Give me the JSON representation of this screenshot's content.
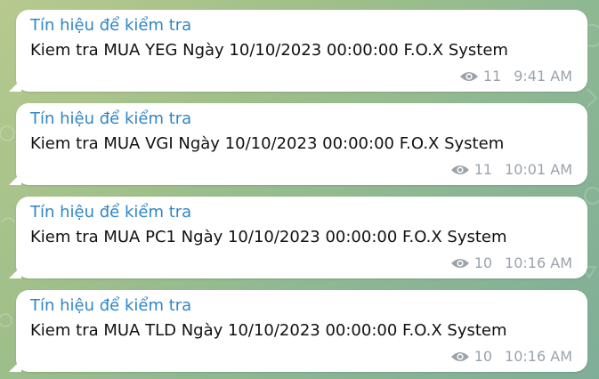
{
  "colors": {
    "sender": "#2f86c8",
    "meta": "#9aa3ab",
    "bubble": "#ffffff"
  },
  "messages": [
    {
      "sender": "Tín hiệu để kiểm tra",
      "text": "Kiem tra MUA YEG Ngày 10/10/2023 00:00:00 F.O.X System",
      "views": "11",
      "time": "9:41 AM"
    },
    {
      "sender": "Tín hiệu để kiểm tra",
      "text": "Kiem tra MUA VGI Ngày 10/10/2023 00:00:00 F.O.X System",
      "views": "11",
      "time": "10:01 AM"
    },
    {
      "sender": "Tín hiệu để kiểm tra",
      "text": "Kiem tra MUA PC1 Ngày 10/10/2023 00:00:00 F.O.X System",
      "views": "10",
      "time": "10:16 AM"
    },
    {
      "sender": "Tín hiệu để kiểm tra",
      "text": "Kiem tra MUA TLD Ngày 10/10/2023 00:00:00 F.O.X System",
      "views": "10",
      "time": "10:16 AM"
    }
  ]
}
